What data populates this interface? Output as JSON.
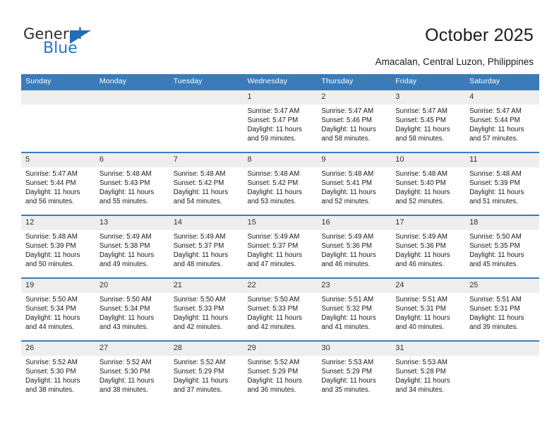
{
  "brand": {
    "name_top": "General",
    "name_bottom": "Blue",
    "accent_color": "#2277c8",
    "triangle_color": "#1f6fb5",
    "triangle_icon": "triangle-icon"
  },
  "header": {
    "title": "October 2025",
    "subtitle": "Amacalan, Central Luzon, Philippines"
  },
  "calendar": {
    "header_bg": "#3b7cb8",
    "daynum_bg": "#eeeeee",
    "weekday_headers": [
      "Sunday",
      "Monday",
      "Tuesday",
      "Wednesday",
      "Thursday",
      "Friday",
      "Saturday"
    ],
    "labels": {
      "sunrise": "Sunrise:",
      "sunset": "Sunset:",
      "daylight": "Daylight:"
    },
    "weeks": [
      [
        {
          "day": "",
          "empty": true
        },
        {
          "day": "",
          "empty": true
        },
        {
          "day": "",
          "empty": true
        },
        {
          "day": "1",
          "sunrise": "Sunrise: 5:47 AM",
          "sunset": "Sunset: 5:47 PM",
          "daylight_1": "Daylight: 11 hours",
          "daylight_2": "and 59 minutes."
        },
        {
          "day": "2",
          "sunrise": "Sunrise: 5:47 AM",
          "sunset": "Sunset: 5:46 PM",
          "daylight_1": "Daylight: 11 hours",
          "daylight_2": "and 58 minutes."
        },
        {
          "day": "3",
          "sunrise": "Sunrise: 5:47 AM",
          "sunset": "Sunset: 5:45 PM",
          "daylight_1": "Daylight: 11 hours",
          "daylight_2": "and 58 minutes."
        },
        {
          "day": "4",
          "sunrise": "Sunrise: 5:47 AM",
          "sunset": "Sunset: 5:44 PM",
          "daylight_1": "Daylight: 11 hours",
          "daylight_2": "and 57 minutes."
        }
      ],
      [
        {
          "day": "5",
          "sunrise": "Sunrise: 5:47 AM",
          "sunset": "Sunset: 5:44 PM",
          "daylight_1": "Daylight: 11 hours",
          "daylight_2": "and 56 minutes."
        },
        {
          "day": "6",
          "sunrise": "Sunrise: 5:48 AM",
          "sunset": "Sunset: 5:43 PM",
          "daylight_1": "Daylight: 11 hours",
          "daylight_2": "and 55 minutes."
        },
        {
          "day": "7",
          "sunrise": "Sunrise: 5:48 AM",
          "sunset": "Sunset: 5:42 PM",
          "daylight_1": "Daylight: 11 hours",
          "daylight_2": "and 54 minutes."
        },
        {
          "day": "8",
          "sunrise": "Sunrise: 5:48 AM",
          "sunset": "Sunset: 5:42 PM",
          "daylight_1": "Daylight: 11 hours",
          "daylight_2": "and 53 minutes."
        },
        {
          "day": "9",
          "sunrise": "Sunrise: 5:48 AM",
          "sunset": "Sunset: 5:41 PM",
          "daylight_1": "Daylight: 11 hours",
          "daylight_2": "and 52 minutes."
        },
        {
          "day": "10",
          "sunrise": "Sunrise: 5:48 AM",
          "sunset": "Sunset: 5:40 PM",
          "daylight_1": "Daylight: 11 hours",
          "daylight_2": "and 52 minutes."
        },
        {
          "day": "11",
          "sunrise": "Sunrise: 5:48 AM",
          "sunset": "Sunset: 5:39 PM",
          "daylight_1": "Daylight: 11 hours",
          "daylight_2": "and 51 minutes."
        }
      ],
      [
        {
          "day": "12",
          "sunrise": "Sunrise: 5:48 AM",
          "sunset": "Sunset: 5:39 PM",
          "daylight_1": "Daylight: 11 hours",
          "daylight_2": "and 50 minutes."
        },
        {
          "day": "13",
          "sunrise": "Sunrise: 5:49 AM",
          "sunset": "Sunset: 5:38 PM",
          "daylight_1": "Daylight: 11 hours",
          "daylight_2": "and 49 minutes."
        },
        {
          "day": "14",
          "sunrise": "Sunrise: 5:49 AM",
          "sunset": "Sunset: 5:37 PM",
          "daylight_1": "Daylight: 11 hours",
          "daylight_2": "and 48 minutes."
        },
        {
          "day": "15",
          "sunrise": "Sunrise: 5:49 AM",
          "sunset": "Sunset: 5:37 PM",
          "daylight_1": "Daylight: 11 hours",
          "daylight_2": "and 47 minutes."
        },
        {
          "day": "16",
          "sunrise": "Sunrise: 5:49 AM",
          "sunset": "Sunset: 5:36 PM",
          "daylight_1": "Daylight: 11 hours",
          "daylight_2": "and 46 minutes."
        },
        {
          "day": "17",
          "sunrise": "Sunrise: 5:49 AM",
          "sunset": "Sunset: 5:36 PM",
          "daylight_1": "Daylight: 11 hours",
          "daylight_2": "and 46 minutes."
        },
        {
          "day": "18",
          "sunrise": "Sunrise: 5:50 AM",
          "sunset": "Sunset: 5:35 PM",
          "daylight_1": "Daylight: 11 hours",
          "daylight_2": "and 45 minutes."
        }
      ],
      [
        {
          "day": "19",
          "sunrise": "Sunrise: 5:50 AM",
          "sunset": "Sunset: 5:34 PM",
          "daylight_1": "Daylight: 11 hours",
          "daylight_2": "and 44 minutes."
        },
        {
          "day": "20",
          "sunrise": "Sunrise: 5:50 AM",
          "sunset": "Sunset: 5:34 PM",
          "daylight_1": "Daylight: 11 hours",
          "daylight_2": "and 43 minutes."
        },
        {
          "day": "21",
          "sunrise": "Sunrise: 5:50 AM",
          "sunset": "Sunset: 5:33 PM",
          "daylight_1": "Daylight: 11 hours",
          "daylight_2": "and 42 minutes."
        },
        {
          "day": "22",
          "sunrise": "Sunrise: 5:50 AM",
          "sunset": "Sunset: 5:33 PM",
          "daylight_1": "Daylight: 11 hours",
          "daylight_2": "and 42 minutes."
        },
        {
          "day": "23",
          "sunrise": "Sunrise: 5:51 AM",
          "sunset": "Sunset: 5:32 PM",
          "daylight_1": "Daylight: 11 hours",
          "daylight_2": "and 41 minutes."
        },
        {
          "day": "24",
          "sunrise": "Sunrise: 5:51 AM",
          "sunset": "Sunset: 5:31 PM",
          "daylight_1": "Daylight: 11 hours",
          "daylight_2": "and 40 minutes."
        },
        {
          "day": "25",
          "sunrise": "Sunrise: 5:51 AM",
          "sunset": "Sunset: 5:31 PM",
          "daylight_1": "Daylight: 11 hours",
          "daylight_2": "and 39 minutes."
        }
      ],
      [
        {
          "day": "26",
          "sunrise": "Sunrise: 5:52 AM",
          "sunset": "Sunset: 5:30 PM",
          "daylight_1": "Daylight: 11 hours",
          "daylight_2": "and 38 minutes."
        },
        {
          "day": "27",
          "sunrise": "Sunrise: 5:52 AM",
          "sunset": "Sunset: 5:30 PM",
          "daylight_1": "Daylight: 11 hours",
          "daylight_2": "and 38 minutes."
        },
        {
          "day": "28",
          "sunrise": "Sunrise: 5:52 AM",
          "sunset": "Sunset: 5:29 PM",
          "daylight_1": "Daylight: 11 hours",
          "daylight_2": "and 37 minutes."
        },
        {
          "day": "29",
          "sunrise": "Sunrise: 5:52 AM",
          "sunset": "Sunset: 5:29 PM",
          "daylight_1": "Daylight: 11 hours",
          "daylight_2": "and 36 minutes."
        },
        {
          "day": "30",
          "sunrise": "Sunrise: 5:53 AM",
          "sunset": "Sunset: 5:29 PM",
          "daylight_1": "Daylight: 11 hours",
          "daylight_2": "and 35 minutes."
        },
        {
          "day": "31",
          "sunrise": "Sunrise: 5:53 AM",
          "sunset": "Sunset: 5:28 PM",
          "daylight_1": "Daylight: 11 hours",
          "daylight_2": "and 34 minutes."
        },
        {
          "day": "",
          "empty": true
        }
      ]
    ]
  }
}
